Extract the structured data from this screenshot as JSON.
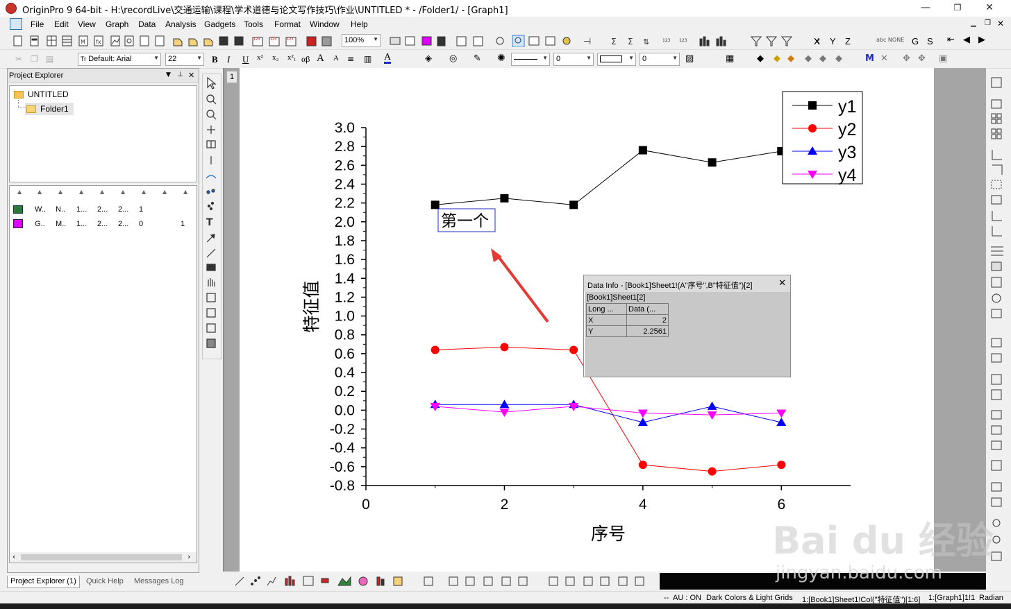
{
  "window": {
    "title": "OriginPro 9 64-bit - H:\\recordLive\\交通运输\\课程\\学术道德与论文写作技巧\\作业\\UNTITLED * - /Folder1/ - [Graph1]",
    "minimize": "—",
    "restore": "❐",
    "close": "✕"
  },
  "menu": [
    "File",
    "Edit",
    "View",
    "Graph",
    "Data",
    "Analysis",
    "Gadgets",
    "Tools",
    "Format",
    "Window",
    "Help"
  ],
  "toolbar": {
    "zoom": "100%",
    "font": "Default: Arial",
    "font_size": "22",
    "bold": "B",
    "italic": "I",
    "underline": "U",
    "alpha_beta": "αβ",
    "line_width_value": "0",
    "fill_value": "0",
    "letters": [
      "X",
      "Y",
      "Z",
      "G",
      "S"
    ]
  },
  "project_explorer": {
    "header": "Project Explorer",
    "root": "UNTITLED",
    "folder": "Folder1",
    "rows": [
      [
        "W..",
        "N..",
        "1...",
        "2...",
        "2...",
        "1",
        ""
      ],
      [
        "G..",
        "M..",
        "1...",
        "2...",
        "2...",
        "0",
        "1"
      ]
    ],
    "tabs": [
      "Project Explorer (1)",
      "Quick Help",
      "Messages Log"
    ]
  },
  "layer_tab": "1",
  "chart_data": {
    "type": "line",
    "xlabel": "序号",
    "ylabel": "特征值",
    "xlim": [
      0,
      7
    ],
    "ylim": [
      -0.8,
      3.0
    ],
    "xticks": [
      "0",
      "2",
      "4",
      "6"
    ],
    "yticks": [
      "3.0",
      "2.8",
      "2.6",
      "2.4",
      "2.2",
      "2.0",
      "1.8",
      "1.6",
      "1.4",
      "1.2",
      "1.0",
      "0.8",
      "0.6",
      "0.4",
      "0.2",
      "0.0",
      "-0.2",
      "-0.4",
      "-0.6",
      "-0.8"
    ],
    "x": [
      1,
      2,
      3,
      4,
      5,
      6
    ],
    "series": [
      {
        "name": "y1",
        "color": "#000000",
        "marker": "square",
        "values": [
          2.18,
          2.25,
          2.18,
          2.76,
          2.63,
          2.75
        ]
      },
      {
        "name": "y2",
        "color": "#ff0000",
        "marker": "circle",
        "values": [
          0.64,
          0.67,
          0.64,
          -0.58,
          -0.65,
          -0.58
        ]
      },
      {
        "name": "y3",
        "color": "#0000ff",
        "marker": "triangle-up",
        "values": [
          0.06,
          0.06,
          0.06,
          -0.13,
          0.04,
          -0.13
        ]
      },
      {
        "name": "y4",
        "color": "#ff00ff",
        "marker": "triangle-down",
        "values": [
          0.04,
          -0.02,
          0.04,
          -0.03,
          -0.05,
          -0.03
        ]
      }
    ],
    "legend": "top-right",
    "annotation": "第一个",
    "arrow_color": "#e53935"
  },
  "data_info": {
    "title": "Data Info - [Book1]Sheet1!(A\"序号\",B\"特征值\")[2]",
    "close": "✕",
    "sheet": "[Book1]Sheet1[2]",
    "col1": "Long ...",
    "col2": "Data (...",
    "rows": [
      [
        "X",
        "2"
      ],
      [
        "Y",
        "2.2561"
      ]
    ]
  },
  "status": {
    "dashes": "--",
    "au": "AU : ON",
    "theme": "Dark Colors & Light Grids",
    "col": "1:[Book1]Sheet1!Col(\"特征值\")[1:6]",
    "graph": "1:[Graph1]1!1",
    "unit": "Radian"
  },
  "watermark": {
    "brand": "Bai du 经验",
    "url": "jingyan.baidu.com"
  }
}
